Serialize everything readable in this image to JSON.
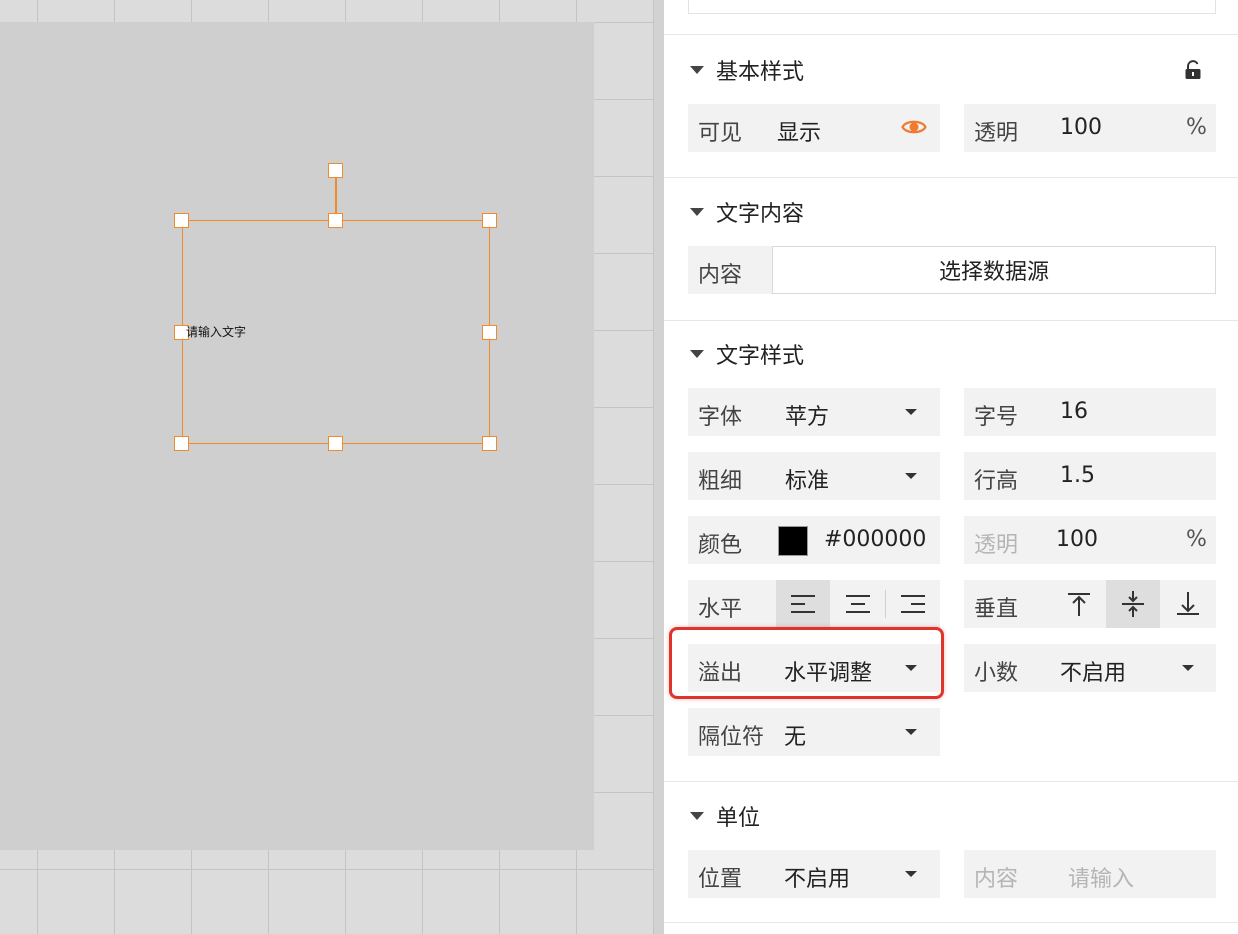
{
  "canvas": {
    "placeholder_text": "请输入文字",
    "accent_color": "#f08a2c"
  },
  "panel": {
    "basic_style": {
      "title": "基本样式",
      "lock_icon": "lock-open-icon",
      "visible_label": "可见",
      "visible_value": "显示",
      "eye_icon": "eye-icon",
      "eye_color": "#f07a30",
      "opacity_label": "透明",
      "opacity_value": "100",
      "opacity_unit": "%"
    },
    "text_content": {
      "title": "文字内容",
      "content_label": "内容",
      "content_button": "选择数据源"
    },
    "text_style": {
      "title": "文字样式",
      "font_label": "字体",
      "font_value": "苹方",
      "size_label": "字号",
      "size_value": "16",
      "weight_label": "粗细",
      "weight_value": "标准",
      "line_height_label": "行高",
      "line_height_value": "1.5",
      "color_label": "颜色",
      "color_value": "#000000",
      "color_opacity_label": "透明",
      "color_opacity_value": "100",
      "color_opacity_unit": "%",
      "horizontal_label": "水平",
      "horizontal_icons": [
        "align-left-icon",
        "align-center-icon",
        "align-right-icon"
      ],
      "vertical_label": "垂直",
      "vertical_icons": [
        "align-top-icon",
        "align-middle-icon",
        "align-bottom-icon"
      ],
      "overflow_label": "溢出",
      "overflow_value": "水平调整",
      "decimal_label": "小数",
      "decimal_value": "不启用",
      "separator_label": "隔位符",
      "separator_value": "无"
    },
    "unit": {
      "title": "单位",
      "position_label": "位置",
      "position_value": "不启用",
      "content_label": "内容",
      "content_placeholder": "请输入"
    },
    "highlight_color": "#e0332b"
  }
}
